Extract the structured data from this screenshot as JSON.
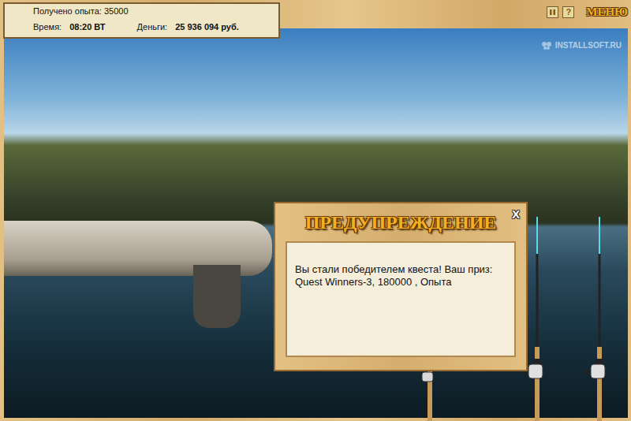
{
  "info": {
    "experience": "Получено опыта: 35000",
    "time_label": "Время:",
    "time": "08:20 ВТ",
    "money_label": "Деньги:",
    "money": "25 936 094 руб."
  },
  "toolbar": {
    "help": "?",
    "menu": "МЕНЮ"
  },
  "watermark": "INSTALLSOFT.RU",
  "dialog": {
    "title": "ПРЕДУПРЕЖДЕНИЕ",
    "close": "X",
    "message": "Вы стали победителем квеста! Ваш приз: Quest Winners-3, 180000 , Опыта"
  }
}
